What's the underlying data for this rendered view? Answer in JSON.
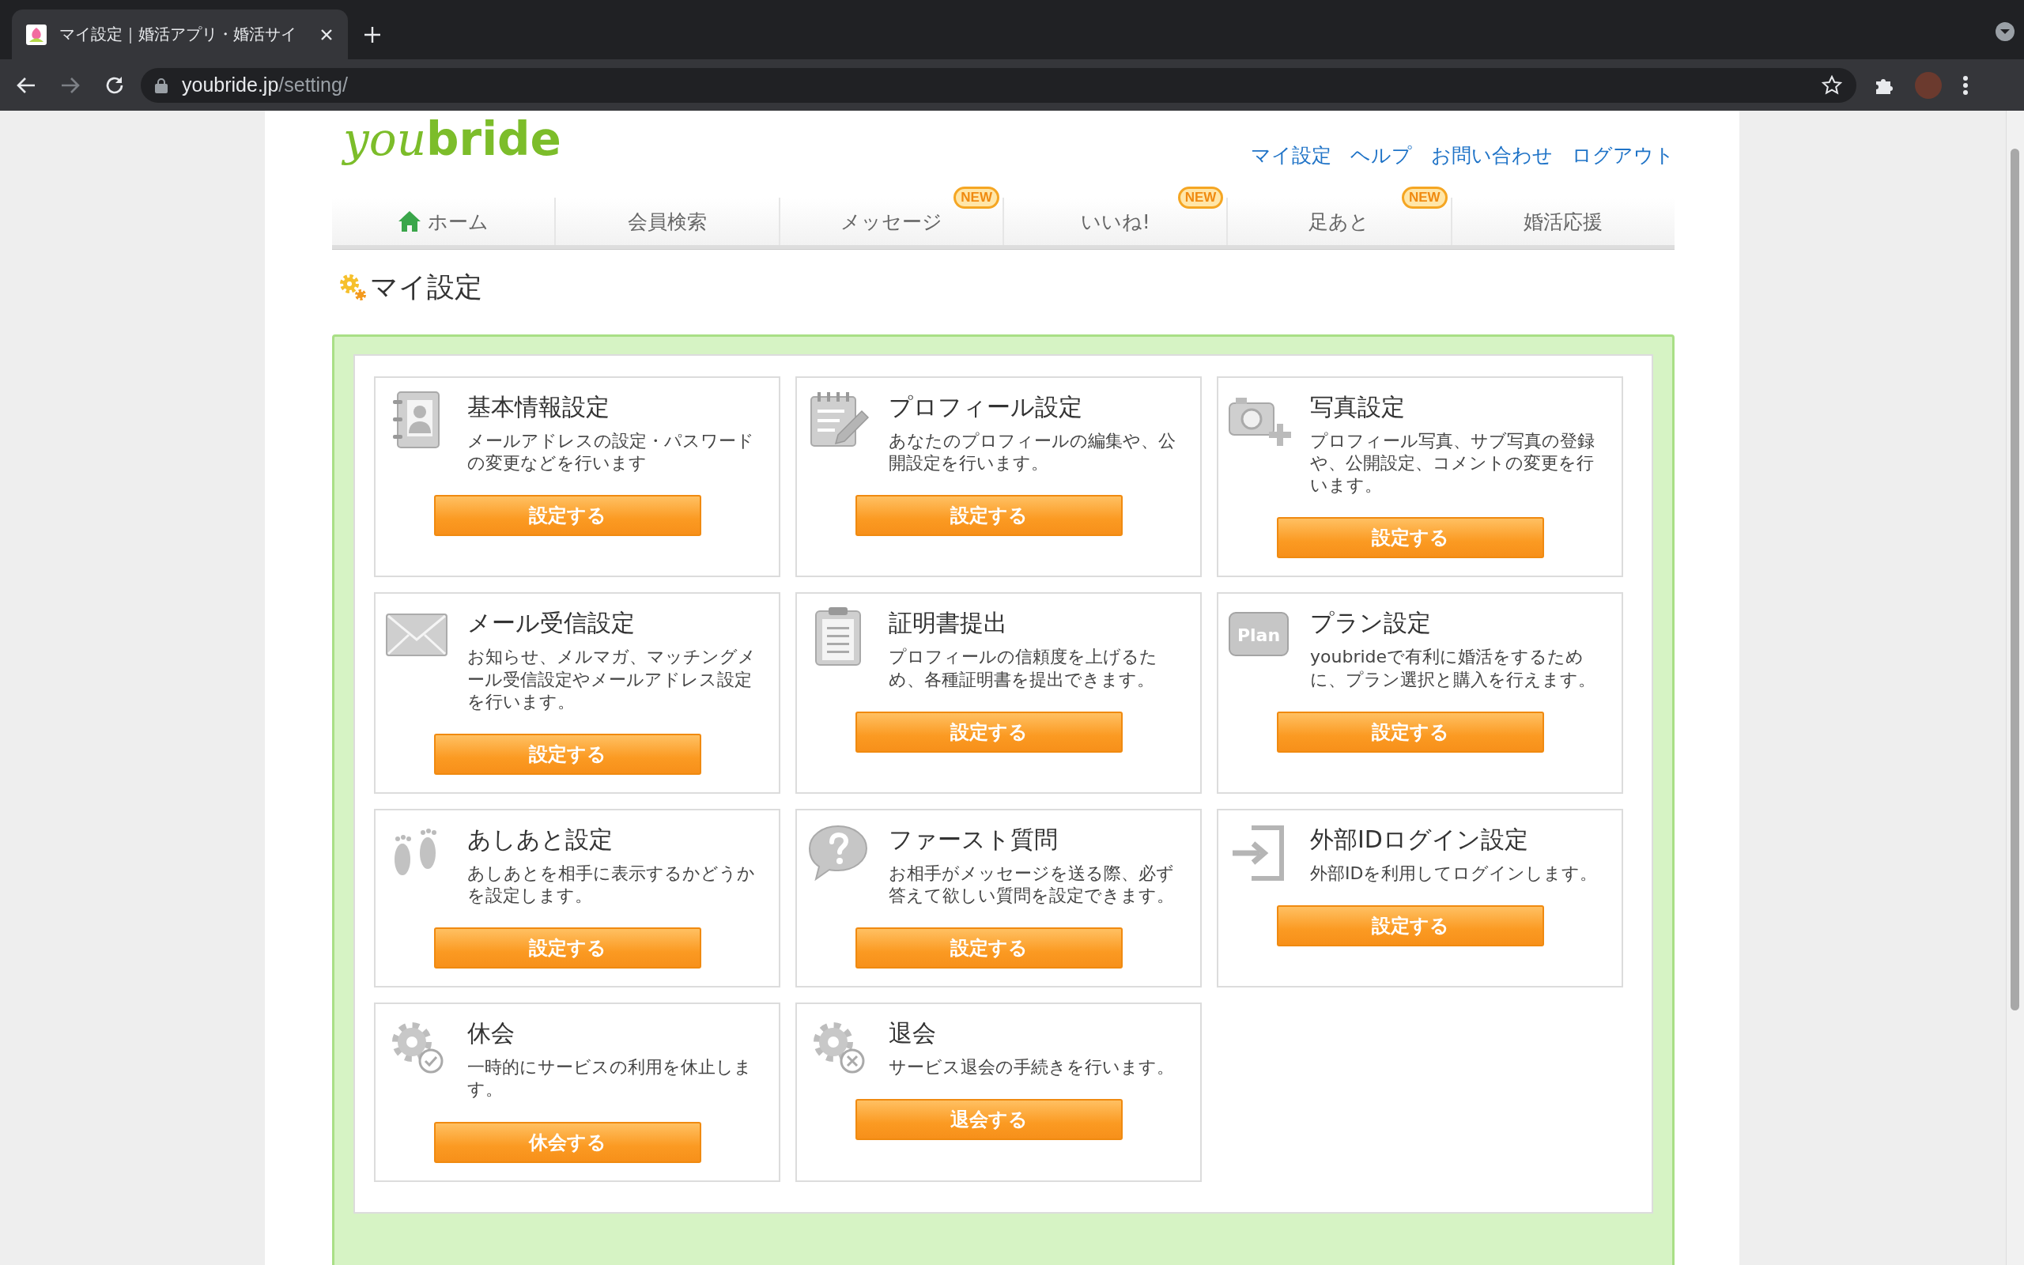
{
  "browser": {
    "tab_title": "マイ設定｜婚活アプリ・婚活サイ",
    "url_host": "youbride.jp",
    "url_path": "/setting/"
  },
  "header": {
    "logo_prefix": "you",
    "logo_suffix": "bride",
    "links": [
      "マイ設定",
      "ヘルプ",
      "お問い合わせ",
      "ログアウト"
    ]
  },
  "nav": [
    {
      "label": "ホーム",
      "kind": "home"
    },
    {
      "label": "会員検索"
    },
    {
      "label": "メッセージ",
      "badge": "NEW"
    },
    {
      "label": "いいね!",
      "badge": "NEW"
    },
    {
      "label": "足あと",
      "badge": "NEW"
    },
    {
      "label": "婚活応援"
    }
  ],
  "page_title": "マイ設定",
  "settings": [
    {
      "kind": "contact-book",
      "title": "基本情報設定",
      "description": "メールアドレスの設定・パスワードの変更などを行います",
      "button": "設定する"
    },
    {
      "kind": "notepad",
      "title": "プロフィール設定",
      "description": "あなたのプロフィールの編集や、公開設定を行います。",
      "button": "設定する"
    },
    {
      "kind": "camera",
      "title": "写真設定",
      "description": "プロフィール写真、サブ写真の登録や、公開設定、コメントの変更を行います。",
      "button": "設定する"
    },
    {
      "kind": "envelope",
      "title": "メール受信設定",
      "description": "お知らせ、メルマガ、マッチングメール受信設定やメールアドレス設定を行います。",
      "button": "設定する"
    },
    {
      "kind": "clipboard",
      "title": "証明書提出",
      "description": "プロフィールの信頼度を上げるため、各種証明書を提出できます。",
      "button": "設定する"
    },
    {
      "kind": "plan",
      "icon_label": "Plan",
      "title": "プラン設定",
      "description": "youbrideで有利に婚活をするために、プラン選択と購入を行えます。",
      "button": "設定する"
    },
    {
      "kind": "footprints",
      "title": "あしあと設定",
      "description": "あしあとを相手に表示するかどうかを設定します。",
      "button": "設定する"
    },
    {
      "kind": "question",
      "title": "ファースト質問",
      "description": "お相手がメッセージを送る際、必ず答えて欲しい質問を設定できます。",
      "button": "設定する"
    },
    {
      "kind": "login",
      "title": "外部IDログイン設定",
      "description": "外部IDを利用してログインします。",
      "button": "設定する"
    },
    {
      "kind": "gear-check",
      "title": "休会",
      "description": "一時的にサービスの利用を休止します。",
      "button": "休会する"
    },
    {
      "kind": "gear-cross",
      "title": "退会",
      "description": "サービス退会の手続きを行います。",
      "button": "退会する"
    }
  ]
}
